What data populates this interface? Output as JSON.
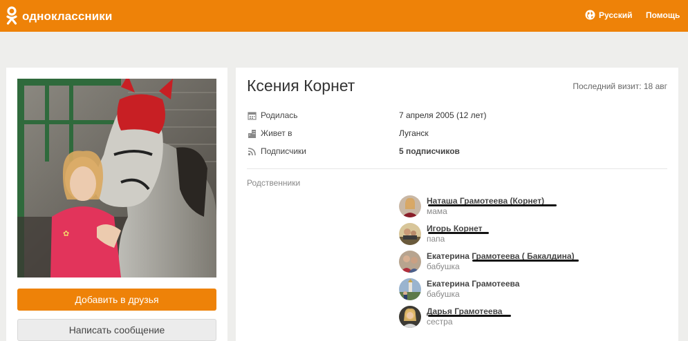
{
  "header": {
    "brand": "одноклассники",
    "brand_color": "#ee8208",
    "language": "Русский",
    "help": "Помощь"
  },
  "left": {
    "photo_icon": "profile-photo",
    "add_friend": "Добавить в друзья",
    "write_message": "Написать сообщение"
  },
  "profile": {
    "name": "Ксения Корнет",
    "last_visit": "Последний визит: 18 авг",
    "info": [
      {
        "icon": "calendar-icon",
        "label": "Родилась",
        "value": "7 апреля 2005 (12 лет)"
      },
      {
        "icon": "building-icon",
        "label": "Живет в",
        "value": "Луганск"
      },
      {
        "icon": "rss-icon",
        "label": "Подписчики",
        "value": "5 подписчиков"
      }
    ],
    "relatives_title": "Родственники",
    "relatives": [
      {
        "name": "Наташа Грамотеева (Корнет)",
        "role": "мама"
      },
      {
        "name": "Игорь Корнет",
        "role": "папа"
      },
      {
        "name": "Екатерина Грамотеева ( Бакалдина)",
        "role": "бабушка"
      },
      {
        "name": "Екатерина Грамотеева",
        "role": "бабушка"
      },
      {
        "name": "Дарья Грамотеева",
        "role": "сестра"
      }
    ]
  }
}
